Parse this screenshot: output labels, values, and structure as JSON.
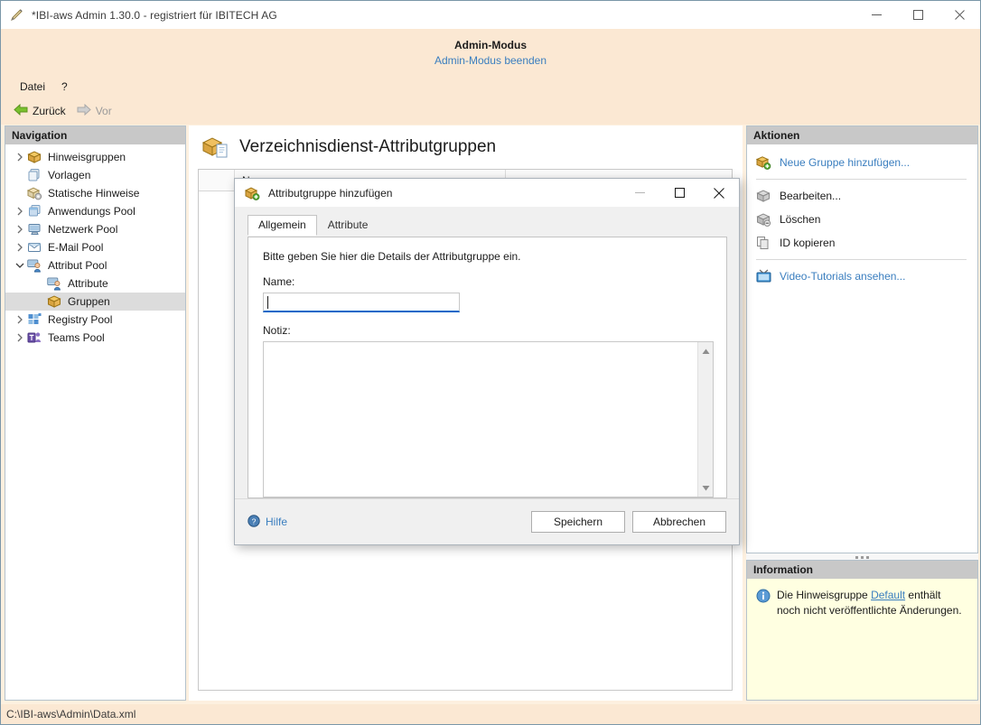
{
  "window": {
    "title": "*IBI-aws Admin 1.30.0 - registriert für IBITECH AG",
    "icon": "app-pen-icon",
    "minimize": "—",
    "maximize": "▢",
    "close": "✕"
  },
  "admin_banner": {
    "title": "Admin-Modus",
    "exit_link": "Admin-Modus beenden"
  },
  "menubar": {
    "items": [
      {
        "label": "Datei"
      },
      {
        "label": "?"
      }
    ]
  },
  "nav_toolbar": {
    "back": "Zurück",
    "forward": "Vor"
  },
  "navigation": {
    "header": "Navigation",
    "items": [
      {
        "label": "Hinweisgruppen",
        "indent": 0,
        "chevron": "right",
        "icon": "package-orange-icon",
        "selected": false
      },
      {
        "label": "Vorlagen",
        "indent": 0,
        "chevron": "none",
        "icon": "templates-icon",
        "selected": false
      },
      {
        "label": "Statische Hinweise",
        "indent": 0,
        "chevron": "none",
        "icon": "static-notice-icon",
        "selected": false
      },
      {
        "label": "Anwendungs Pool",
        "indent": 0,
        "chevron": "right",
        "icon": "applications-icon",
        "selected": false
      },
      {
        "label": "Netzwerk Pool",
        "indent": 0,
        "chevron": "right",
        "icon": "network-icon",
        "selected": false
      },
      {
        "label": "E-Mail Pool",
        "indent": 0,
        "chevron": "right",
        "icon": "email-icon",
        "selected": false
      },
      {
        "label": "Attribut Pool",
        "indent": 0,
        "chevron": "down",
        "icon": "attribute-pool-icon",
        "selected": false
      },
      {
        "label": "Attribute",
        "indent": 1,
        "chevron": "none",
        "icon": "attribute-icon",
        "selected": false
      },
      {
        "label": "Gruppen",
        "indent": 1,
        "chevron": "none",
        "icon": "package-orange-icon",
        "selected": true
      },
      {
        "label": "Registry Pool",
        "indent": 0,
        "chevron": "right",
        "icon": "registry-icon",
        "selected": false
      },
      {
        "label": "Teams Pool",
        "indent": 0,
        "chevron": "right",
        "icon": "teams-icon",
        "selected": false
      }
    ]
  },
  "main": {
    "title": "Verzeichnisdienst-Attributgruppen",
    "icon": "directory-group-icon",
    "grid": {
      "columns": [
        "",
        "N"
      ]
    }
  },
  "actions": {
    "header": "Aktionen",
    "items": [
      {
        "label": "Neue Gruppe hinzufügen...",
        "icon": "add-package-icon",
        "link": true,
        "sep_after": true
      },
      {
        "label": "Bearbeiten...",
        "icon": "edit-package-icon",
        "link": false,
        "sep_after": false
      },
      {
        "label": "Löschen",
        "icon": "delete-package-icon",
        "link": false,
        "sep_after": false
      },
      {
        "label": "ID kopieren",
        "icon": "copy-icon",
        "link": false,
        "sep_after": true
      },
      {
        "label": "Video-Tutorials ansehen...",
        "icon": "tv-icon",
        "link": true,
        "sep_after": false
      }
    ]
  },
  "information": {
    "header": "Information",
    "icon": "info-icon",
    "text_before": "Die Hinweisgruppe ",
    "link": "Default",
    "text_after": " enthält noch nicht veröffentlichte Änderungen."
  },
  "statusbar": {
    "path": "C:\\IBI-aws\\Admin\\Data.xml"
  },
  "dialog": {
    "title": "Attributgruppe hinzufügen",
    "icon": "add-package-icon",
    "minimize": "—",
    "maximize": "▢",
    "close": "✕",
    "tabs": [
      {
        "label": "Allgemein",
        "active": true
      },
      {
        "label": "Attribute",
        "active": false
      }
    ],
    "hint": "Bitte geben Sie hier die Details der Attributgruppe ein.",
    "name_label": "Name:",
    "name_value": "",
    "name_placeholder": "",
    "notiz_label": "Notiz:",
    "notiz_value": "",
    "help_label": "Hilfe",
    "help_icon": "help-icon",
    "save_label": "Speichern",
    "cancel_label": "Abbrechen",
    "scroll_up": "▲",
    "scroll_down": "▼"
  },
  "colors": {
    "banner": "#fbe8d3",
    "link": "#3a7ebf",
    "accent_underline": "#0a68c8",
    "panel_header": "#c8c8c8",
    "info_bg": "#ffffe1",
    "selection": "#dcdcdc"
  }
}
